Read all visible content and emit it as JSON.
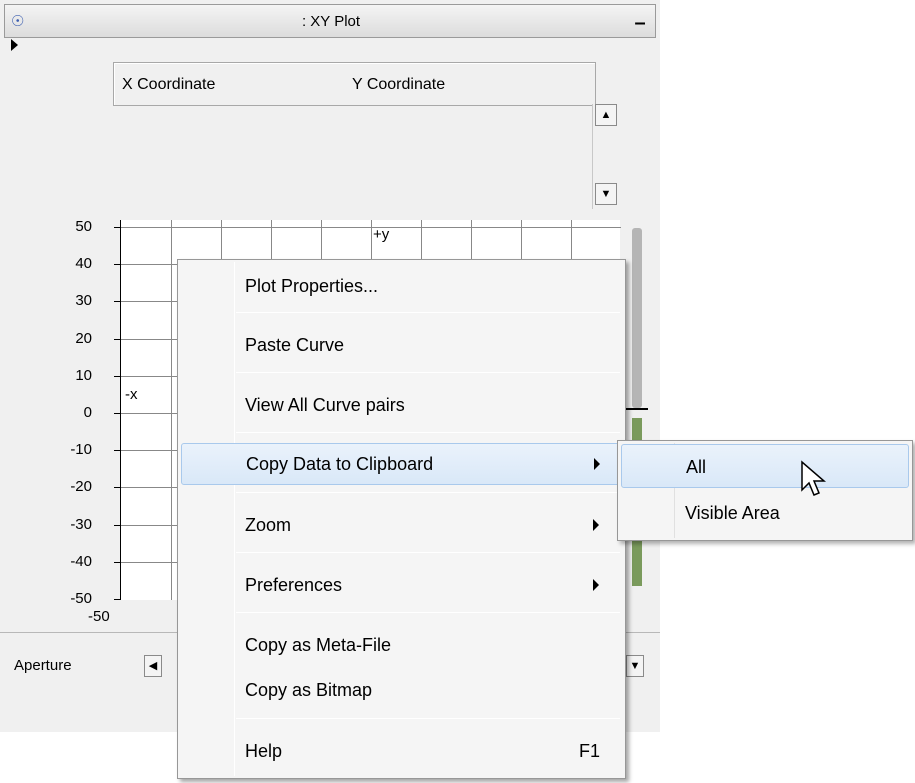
{
  "window": {
    "title": ": XY Plot",
    "icon": "eye-icon",
    "minimize_label": "–"
  },
  "coord_header": {
    "x_label": "X Coordinate",
    "y_label": "Y Coordinate"
  },
  "plot": {
    "y_ticks": [
      "50",
      "40",
      "30",
      "20",
      "10",
      "0",
      "-10",
      "-20",
      "-30",
      "-40",
      "-50"
    ],
    "x_min_label": "-50",
    "plus_y_label": "+y",
    "minus_x_label": "-x"
  },
  "bottom": {
    "aperture_label": "Aperture"
  },
  "context_menu": {
    "items": [
      {
        "label": "Plot Properties...",
        "submenu": false,
        "shortcut": ""
      },
      {
        "label": "Paste Curve",
        "submenu": false,
        "shortcut": ""
      },
      {
        "label": "View All Curve pairs",
        "submenu": false,
        "shortcut": ""
      },
      {
        "label": "Copy Data to Clipboard",
        "submenu": true,
        "shortcut": "",
        "highlighted": true
      },
      {
        "label": "Zoom",
        "submenu": true,
        "shortcut": ""
      },
      {
        "label": "Preferences",
        "submenu": true,
        "shortcut": ""
      },
      {
        "label": "Copy as Meta-File",
        "submenu": false,
        "shortcut": ""
      },
      {
        "label": "Copy as Bitmap",
        "submenu": false,
        "shortcut": ""
      },
      {
        "label": "Help",
        "submenu": false,
        "shortcut": "F1"
      }
    ]
  },
  "submenu": {
    "items": [
      {
        "label": "All",
        "highlighted": true
      },
      {
        "label": "Visible Area",
        "highlighted": false
      }
    ]
  },
  "colors": {
    "highlight": "#d9e8f8",
    "highlight_border": "#a9c9ec",
    "scroll_green": "#7a9a5c"
  }
}
